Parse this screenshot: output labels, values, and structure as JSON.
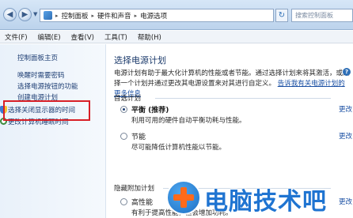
{
  "address": {
    "history_arrow": "▼",
    "breadcrumbs": [
      "控制面板",
      "硬件和声音",
      "电源选项"
    ],
    "separator": "▸",
    "search_placeholder": "搜索控制面板"
  },
  "menu": [
    "文件(F)",
    "编辑(E)",
    "查看(V)",
    "工具(T)",
    "帮助(H)"
  ],
  "sidebar": {
    "home": "控制面板主页",
    "items": [
      "唤醒时需要密码",
      "选择电源按钮的功能",
      "创建电源计划",
      "选择关闭显示器的时间",
      "更改计算机睡眠时间"
    ]
  },
  "main": {
    "title": "选择电源计划",
    "description": "电源计划有助于最大化计算机的性能或者节能。通过选择计划来将其激活，或选择一个计划并通过更改其电源设置来对其进行自定义。",
    "description_link": "告诉我有关电源计划的更多信息",
    "help_icon": "?",
    "preferred_label": "首选计划",
    "hidden_label": "隐藏附加计划",
    "change_label": "更改",
    "plans": [
      {
        "name": "平衡 (推荐)",
        "desc": "利用可用的硬件自动平衡功耗与性能。",
        "selected": true
      },
      {
        "name": "节能",
        "desc": "尽可能降低计算机性能以节能。",
        "selected": false
      },
      {
        "name": "高性能",
        "desc": "有利于提高性能，但会增加功耗。",
        "selected": false
      }
    ]
  },
  "watermark": {
    "text": "电脑技术吧"
  },
  "colors": {
    "highlight": "#d81f26",
    "link": "#1a4fa3",
    "accent": "#2f6fb6",
    "watermark": "#1f74d1"
  }
}
